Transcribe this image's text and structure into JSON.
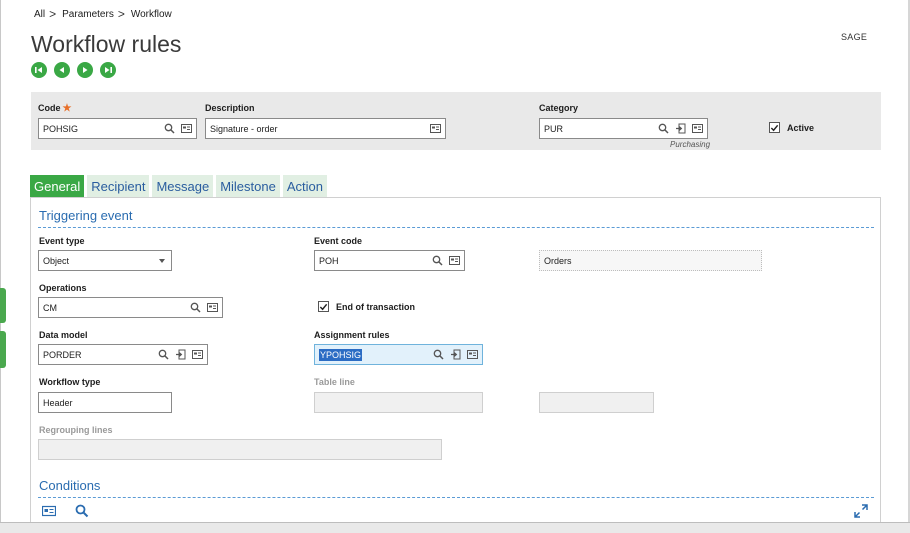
{
  "breadcrumb": {
    "items": [
      "All",
      "Parameters",
      "Workflow"
    ],
    "sep": ">"
  },
  "page": {
    "title": "Workflow rules",
    "product": "SAGE"
  },
  "colors": {
    "accent_green": "#3aa845",
    "link_blue": "#2a6cb0",
    "required": "#e8702a"
  },
  "navigation": {
    "icons": [
      "first-record-icon",
      "previous-record-icon",
      "next-record-icon",
      "last-record-icon"
    ]
  },
  "header": {
    "code": {
      "label": "Code",
      "required_mark": "★",
      "value": "POHSIG"
    },
    "description": {
      "label": "Description",
      "value": "Signature - order"
    },
    "category": {
      "label": "Category",
      "value": "PUR",
      "caption": "Purchasing"
    },
    "active": {
      "label": "Active",
      "checked": true
    }
  },
  "tabs": [
    {
      "label": "General",
      "active": true
    },
    {
      "label": "Recipient",
      "active": false
    },
    {
      "label": "Message",
      "active": false
    },
    {
      "label": "Milestone",
      "active": false
    },
    {
      "label": "Action",
      "active": false
    }
  ],
  "triggering": {
    "title": "Triggering event",
    "event_type": {
      "label": "Event type",
      "value": "Object"
    },
    "event_code": {
      "label": "Event code",
      "value": "POH",
      "description": "Orders"
    },
    "operations": {
      "label": "Operations",
      "value": "CM"
    },
    "end_of_transaction": {
      "label": "End of transaction",
      "checked": true
    },
    "data_model": {
      "label": "Data model",
      "value": "PORDER"
    },
    "assignment_rules": {
      "label": "Assignment rules",
      "value": "YPOHSIG"
    },
    "workflow_type": {
      "label": "Workflow type",
      "value": "Header"
    },
    "table_line": {
      "label": "Table line",
      "value": ""
    },
    "regrouping_lines": {
      "label": "Regrouping lines",
      "value": ""
    }
  },
  "conditions": {
    "title": "Conditions"
  }
}
